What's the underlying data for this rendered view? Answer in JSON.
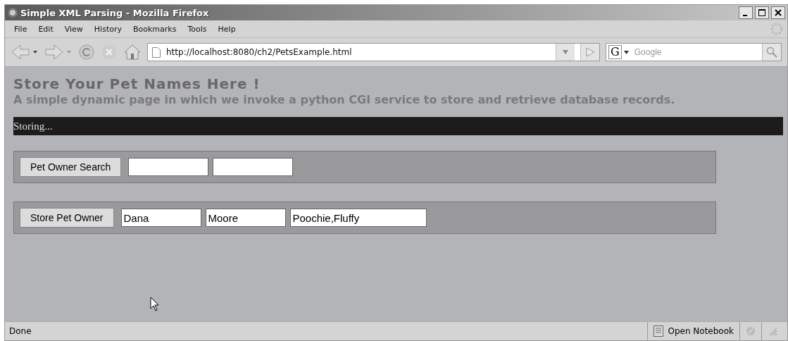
{
  "window": {
    "title": "Simple XML Parsing - Mozilla Firefox"
  },
  "menu": [
    "File",
    "Edit",
    "View",
    "History",
    "Bookmarks",
    "Tools",
    "Help"
  ],
  "address": {
    "value": "http://localhost:8080/ch2/PetsExample.html"
  },
  "search": {
    "placeholder": "Google",
    "engine": "G"
  },
  "page": {
    "heading": "Store Your Pet Names Here !",
    "subtitle": "A simple dynamic page in which we invoke a python CGI service to store and retrieve database records.",
    "status_message": "Storing...",
    "forms": [
      {
        "button": "Pet Owner Search",
        "fields": [
          {
            "kind": "text"
          },
          {
            "kind": "text"
          }
        ]
      },
      {
        "button": "Store Pet Owner",
        "fields": [
          {
            "kind": "text",
            "value": "Dana"
          },
          {
            "kind": "text",
            "value": "Moore"
          },
          {
            "kind": "text",
            "value": "Poochie,Fluffy"
          }
        ]
      }
    ]
  },
  "status_bar": {
    "text": "Done",
    "notebook": "Open Notebook"
  }
}
